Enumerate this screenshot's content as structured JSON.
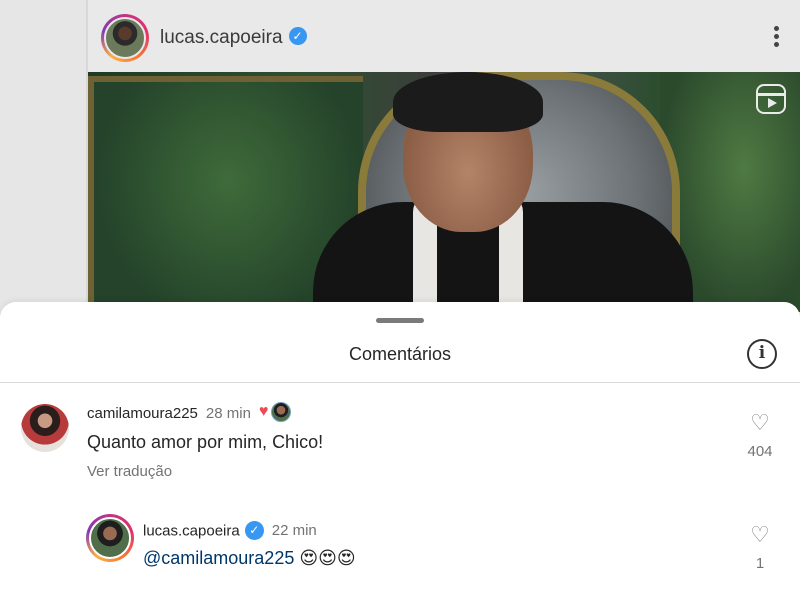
{
  "post": {
    "username": "lucas.capoeira",
    "verified_icon": "verified-badge-icon",
    "menu_icon": "more-vertical-icon",
    "media_icon": "reels-icon"
  },
  "comments_sheet": {
    "title": "Comentários",
    "info_icon": "info-icon",
    "info_glyph": "i",
    "comments": [
      {
        "username": "camilamoura225",
        "time": "28 min",
        "liked_by_author": true,
        "text": "Quanto amor por mim, Chico!",
        "translate_label": "Ver tradução",
        "likes": "404"
      },
      {
        "username": "lucas.capoeira",
        "verified": true,
        "time": "22 min",
        "mention": "@camilamoura225",
        "emojis": "😍😍😍",
        "likes": "1"
      }
    ]
  },
  "colors": {
    "verified": "#3897f0",
    "heart": "#ed4956",
    "mention": "#00376b",
    "secondary_text": "#737373"
  }
}
